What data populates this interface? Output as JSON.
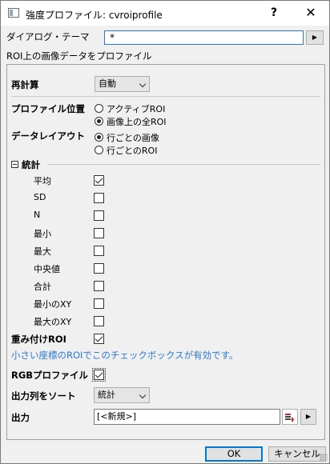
{
  "window": {
    "title": "強度プロファイル: cvroiprofile",
    "help_label": "?",
    "close_label": "✕"
  },
  "theme": {
    "label": "ダイアログ・テーマ",
    "value": "*",
    "arrow": "▶"
  },
  "description": "ROI上の画像データをプロファイル",
  "recalc": {
    "label": "再計算",
    "value": "自動"
  },
  "profile_position": {
    "label": "プロファイル位置",
    "options": [
      {
        "label": "アクティブROI",
        "selected": false
      },
      {
        "label": "画像上の全ROI",
        "selected": true
      }
    ]
  },
  "data_layout": {
    "label": "データレイアウト",
    "options": [
      {
        "label": "行ごとの画像",
        "selected": true
      },
      {
        "label": "行ごとのROI",
        "selected": false
      }
    ]
  },
  "statistics": {
    "label": "統計",
    "items": [
      {
        "label": "平均",
        "checked": true
      },
      {
        "label": "SD",
        "checked": false
      },
      {
        "label": "N",
        "checked": false
      },
      {
        "label": "最小",
        "checked": false
      },
      {
        "label": "最大",
        "checked": false
      },
      {
        "label": "中央値",
        "checked": false
      },
      {
        "label": "合計",
        "checked": false
      },
      {
        "label": "最小のXY",
        "checked": false
      },
      {
        "label": "最大のXY",
        "checked": false
      }
    ]
  },
  "weighted_roi": {
    "label": "重み付けROI",
    "checked": true
  },
  "hint": "小さい座標のROIでこのチェックボックスが有効です。",
  "rgb_profile": {
    "label": "RGBプロファイル",
    "checked": true
  },
  "sort_output": {
    "label": "出力列をソート",
    "value": "統計"
  },
  "output": {
    "label": "出力",
    "value": "[<新規>]",
    "arrow": "▶"
  },
  "buttons": {
    "ok": "OK",
    "cancel": "キャンセル"
  },
  "colors": {
    "accent": "#2b78d0",
    "hint_text": "#2b78d0",
    "focus_border": "#0078d7"
  }
}
